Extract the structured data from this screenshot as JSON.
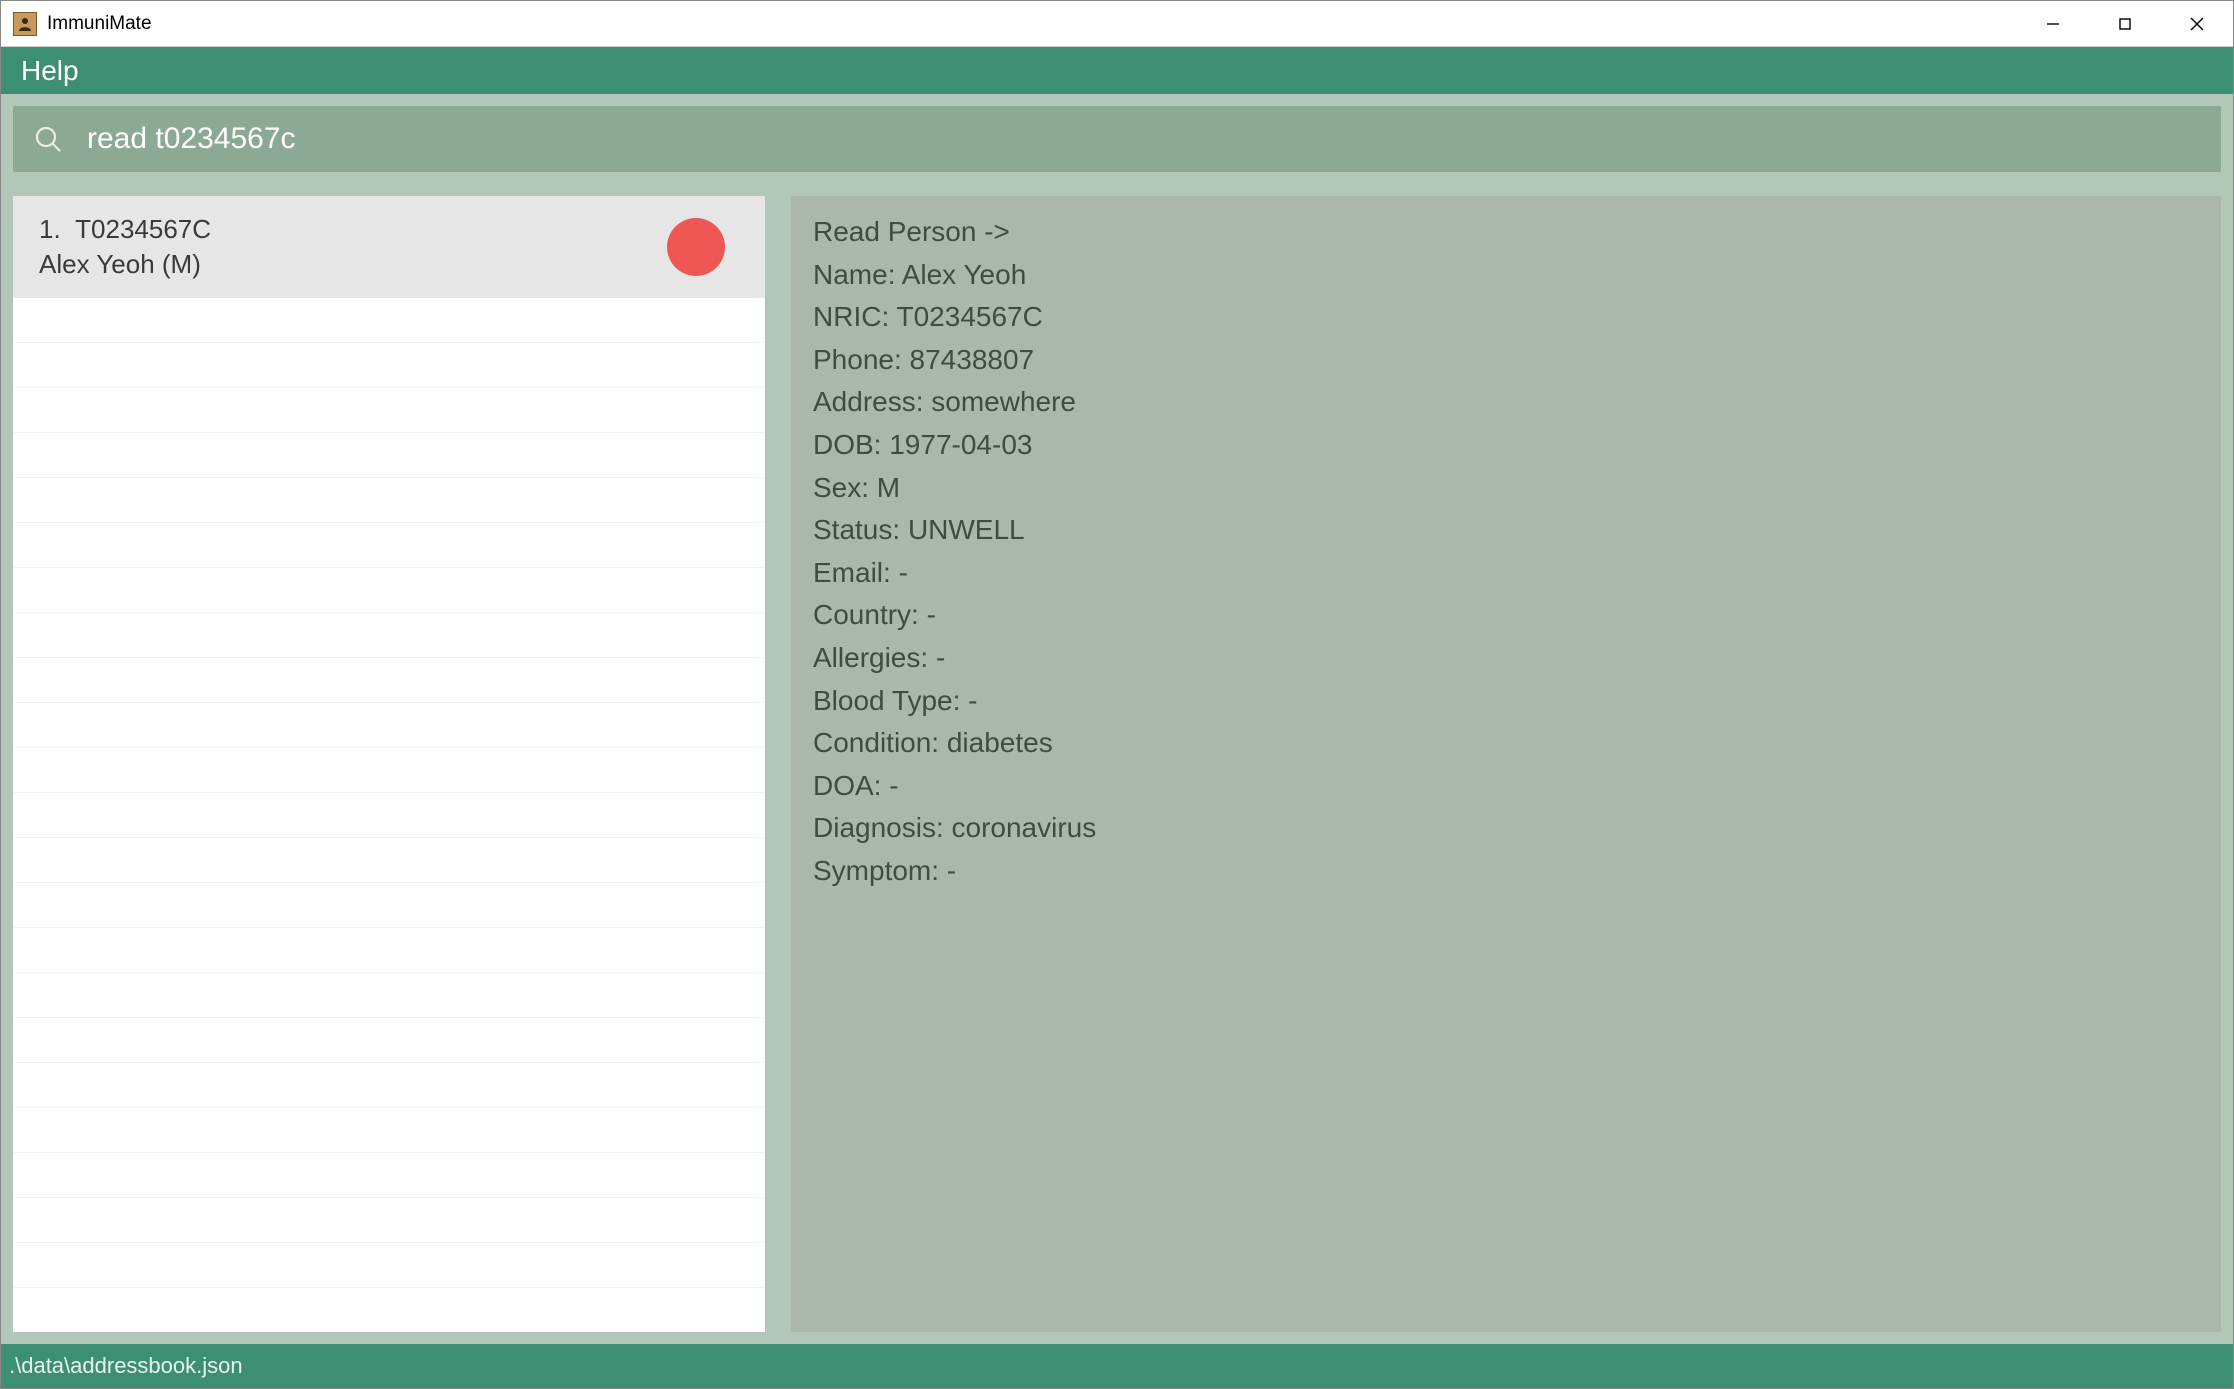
{
  "window": {
    "title": "ImmuniMate"
  },
  "menubar": {
    "help": "Help"
  },
  "command": {
    "value": "read t0234567c"
  },
  "list": {
    "items": [
      {
        "index": "1.",
        "code": "T0234567C",
        "name": "Alex Yeoh (M)",
        "status_color": "#ef5755"
      }
    ]
  },
  "details": {
    "lines": [
      "Read Person ->",
      "Name: Alex Yeoh",
      "NRIC: T0234567C",
      "Phone: 87438807",
      "Address: somewhere",
      "DOB: 1977-04-03",
      "Sex: M",
      "Status: UNWELL",
      "Email: -",
      "Country: -",
      "Allergies: -",
      "Blood Type: -",
      "Condition: diabetes",
      "DOA: -",
      "Diagnosis: coronavirus",
      "Symptom: -"
    ]
  },
  "statusbar": {
    "path": ".\\data\\addressbook.json"
  }
}
